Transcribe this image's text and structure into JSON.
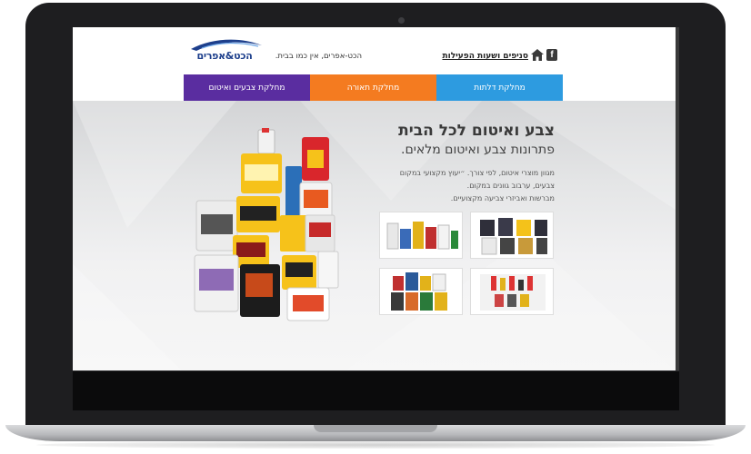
{
  "header": {
    "logo_text": "הכט&אפרים",
    "tagline": "הכט-אפרים, אין כמו בבית.",
    "branches_link": "סניפים ושעות הפעילות",
    "icons": [
      "home-icon",
      "facebook-icon"
    ]
  },
  "tabs": [
    {
      "label": "מחלקת צבעים ואיטום",
      "color": "#5a2da0"
    },
    {
      "label": "מחלקת תאורה",
      "color": "#f47b20"
    },
    {
      "label": "מחלקת דלתות",
      "color": "#2d9be0"
    }
  ],
  "hero": {
    "title": "צבע ואיטום לכל הבית",
    "subtitle": "פתרונות צבע ואיטום מלאים.",
    "body_lines": [
      "מגוון מוצרי איטום, לפי צורך. ״יעוץ מקצועי במקום",
      "צבעים, ערבוב גוונים במקום.",
      "מברשות ואביזרי צביעה מקצועיים."
    ]
  },
  "colors": {
    "purple": "#5a2da0",
    "orange": "#f47b20",
    "blue": "#2d9be0",
    "logo_blue": "#1d3f8c"
  }
}
